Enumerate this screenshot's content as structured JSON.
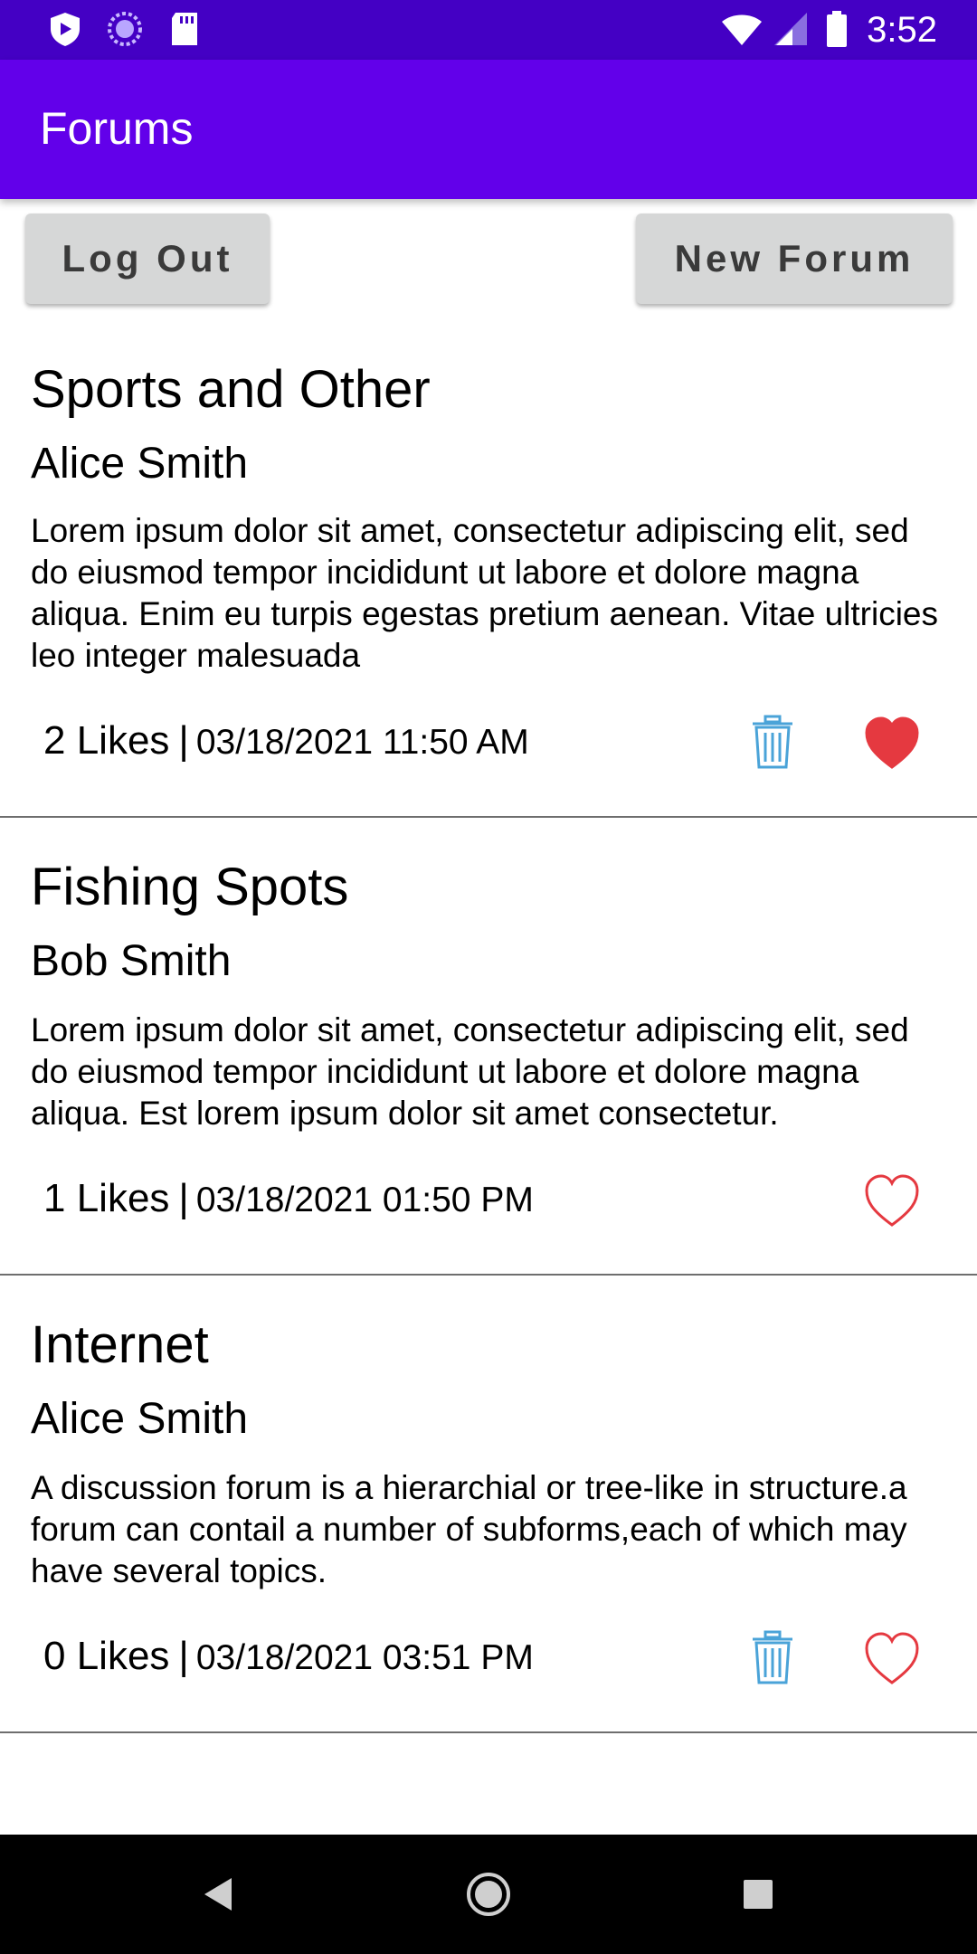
{
  "status_bar": {
    "time": "3:52",
    "left_icons": [
      "shield-icon",
      "sync-icon",
      "sd-card-icon"
    ],
    "right_icons": [
      "wifi-icon",
      "signal-icon",
      "battery-icon"
    ]
  },
  "app_bar": {
    "title": "Forums"
  },
  "actions": {
    "logout_label": "Log Out",
    "new_forum_label": "New Forum"
  },
  "forums": [
    {
      "title": "Sports and Other",
      "author": "Alice Smith",
      "body": "Lorem ipsum dolor sit amet, consectetur adipiscing elit, sed do eiusmod tempor incididunt ut labore et dolore magna aliqua. Enim eu turpis egestas pretium aenean. Vitae ultricies leo integer malesuada",
      "likes": "2 Likes",
      "separator": "|",
      "date": "03/18/2021 11:50 AM",
      "can_delete": true,
      "liked": true
    },
    {
      "title": "Fishing Spots",
      "author": "Bob Smith",
      "body": "Lorem ipsum dolor sit amet, consectetur adipiscing elit, sed do eiusmod tempor incididunt ut labore et dolore magna aliqua. Est lorem ipsum dolor sit amet consectetur.",
      "likes": "1 Likes",
      "separator": "|",
      "date": "03/18/2021 01:50 PM",
      "can_delete": false,
      "liked": false
    },
    {
      "title": "Internet",
      "author": "Alice Smith",
      "body": "A discussion forum is a hierarchial or tree-like in structure.a forum can contail a number of subforms,each of which may have several topics.",
      "likes": "0 Likes",
      "separator": "|",
      "date": "03/18/2021 03:51 PM",
      "can_delete": true,
      "liked": false
    }
  ],
  "nav_bar": {
    "buttons": [
      "back-icon",
      "home-icon",
      "recents-icon"
    ]
  },
  "colors": {
    "status_bar": "#4400c4",
    "app_bar": "#6200ea",
    "button_bg": "#d6d7d7",
    "delete_icon": "#4aa3d8",
    "heart": "#e53940"
  }
}
